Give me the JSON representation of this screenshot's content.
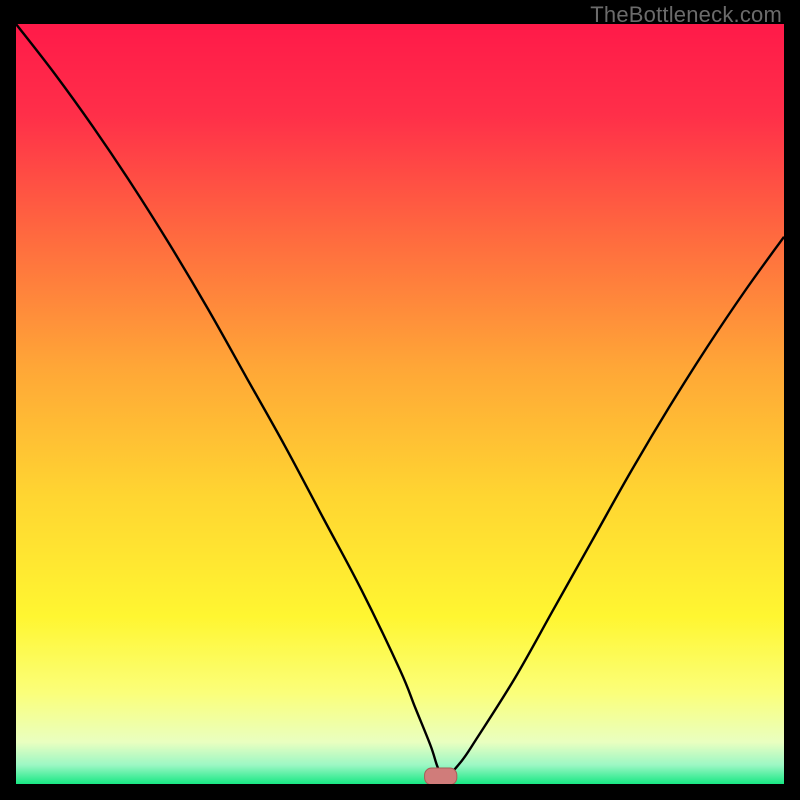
{
  "watermark": "TheBottleneck.com",
  "colors": {
    "gradient_stops": [
      {
        "offset": 0.0,
        "color": "#ff1a49"
      },
      {
        "offset": 0.12,
        "color": "#ff2f49"
      },
      {
        "offset": 0.28,
        "color": "#ff6a3f"
      },
      {
        "offset": 0.45,
        "color": "#ffa637"
      },
      {
        "offset": 0.62,
        "color": "#ffd531"
      },
      {
        "offset": 0.78,
        "color": "#fff631"
      },
      {
        "offset": 0.88,
        "color": "#fbff7a"
      },
      {
        "offset": 0.945,
        "color": "#e9ffc0"
      },
      {
        "offset": 0.975,
        "color": "#9cf7c4"
      },
      {
        "offset": 1.0,
        "color": "#18e884"
      }
    ],
    "curve": "#000000",
    "marker_fill": "#d07c7a",
    "marker_stroke": "#a85c58"
  },
  "chart_data": {
    "type": "line",
    "title": "",
    "xlabel": "",
    "ylabel": "",
    "xlim": [
      0,
      100
    ],
    "ylim": [
      0,
      100
    ],
    "series": [
      {
        "name": "bottleneck-curve",
        "x": [
          0,
          5,
          10,
          15,
          20,
          25,
          30,
          35,
          40,
          45,
          50,
          52,
          54,
          55,
          56,
          58,
          60,
          65,
          70,
          75,
          80,
          85,
          90,
          95,
          100
        ],
        "y": [
          100,
          93.5,
          86.5,
          79,
          71,
          62.5,
          53.5,
          44.5,
          35,
          25.5,
          15,
          10,
          5,
          2,
          1,
          3,
          6,
          14,
          23,
          32,
          41,
          49.5,
          57.5,
          65,
          72
        ]
      }
    ],
    "marker": {
      "x": 55.3,
      "y": 1.0,
      "rx": 2.1,
      "ry": 1.1
    },
    "annotations": []
  }
}
